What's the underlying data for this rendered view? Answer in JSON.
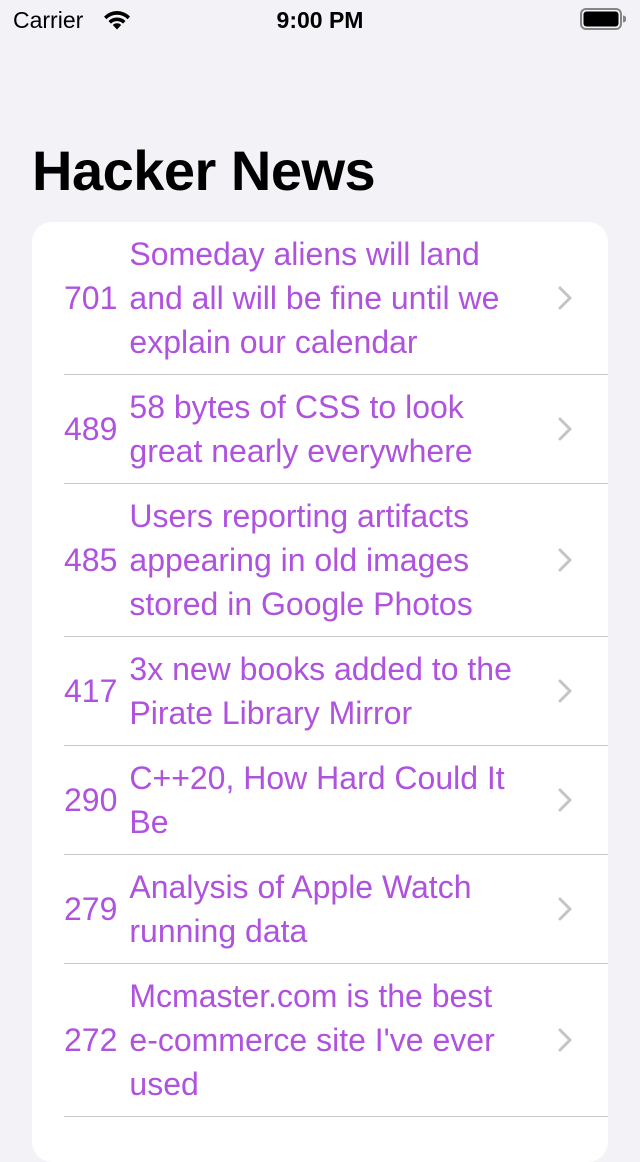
{
  "status_bar": {
    "carrier": "Carrier",
    "time": "9:00 PM"
  },
  "header": {
    "title": "Hacker News"
  },
  "colors": {
    "accent": "#af52de",
    "background": "#f2f2f7",
    "card": "#ffffff",
    "separator": "#c6c6c8",
    "chevron": "#c4c4c7"
  },
  "stories": [
    {
      "score": "701",
      "title": "Someday aliens will land and all will be fine until we explain our calendar"
    },
    {
      "score": "489",
      "title": "58 bytes of CSS to look great nearly everywhere"
    },
    {
      "score": "485",
      "title": "Users reporting artifacts appearing in old images stored in Google Photos"
    },
    {
      "score": "417",
      "title": "3x new books added to the Pirate Library Mirror"
    },
    {
      "score": "290",
      "title": "C++20, How Hard Could It Be"
    },
    {
      "score": "279",
      "title": "Analysis of Apple Watch running data"
    },
    {
      "score": "272",
      "title": "Mcmaster.com is the best e-commerce site I've ever used"
    }
  ],
  "icons": {
    "wifi": "wifi-icon",
    "battery": "battery-icon",
    "chevron": "chevron-right-icon"
  }
}
